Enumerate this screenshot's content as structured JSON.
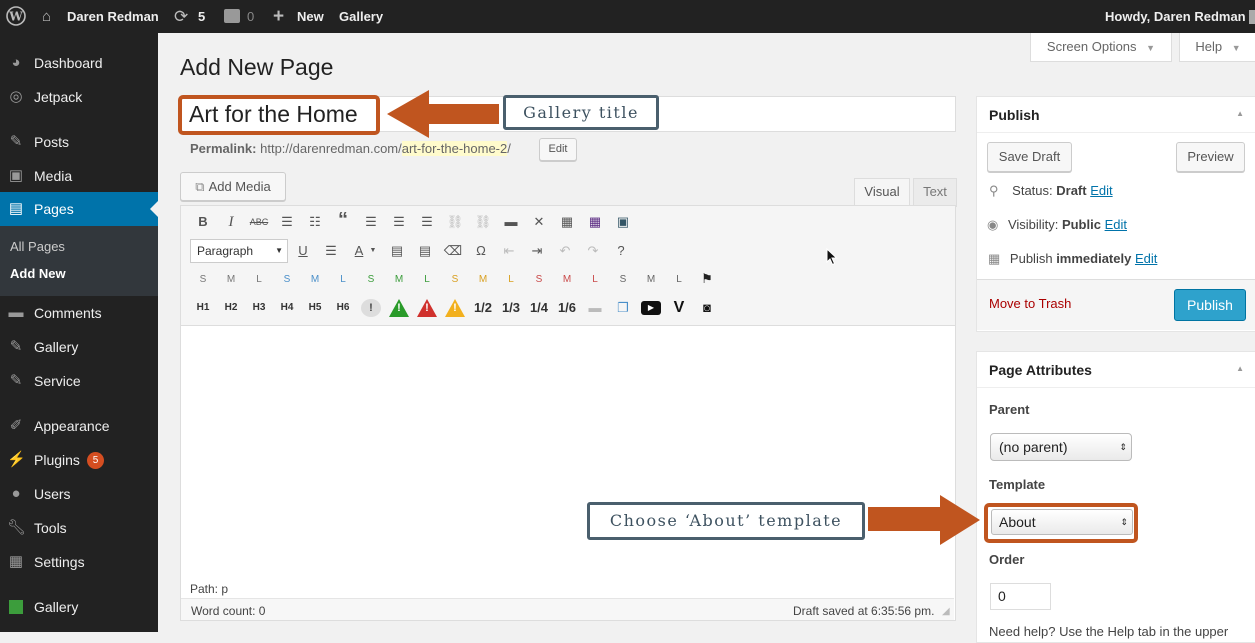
{
  "admin_bar": {
    "site_name": "Daren Redman",
    "updates_count": "5",
    "comments_count": "0",
    "new_label": "New",
    "gallery_label": "Gallery",
    "howdy": "Howdy, Daren Redman"
  },
  "sidebar": {
    "items": [
      {
        "label": "Dashboard",
        "icon": "dashboard-icon"
      },
      {
        "label": "Jetpack",
        "icon": "jetpack-icon"
      },
      {
        "label": "Posts",
        "icon": "pin-icon"
      },
      {
        "label": "Media",
        "icon": "media-icon"
      },
      {
        "label": "Pages",
        "icon": "pages-icon"
      },
      {
        "label": "Comments",
        "icon": "comment-icon"
      },
      {
        "label": "Gallery",
        "icon": "pin-icon"
      },
      {
        "label": "Service",
        "icon": "pin-icon"
      },
      {
        "label": "Appearance",
        "icon": "brush-icon"
      },
      {
        "label": "Plugins",
        "icon": "plug-icon",
        "badge": "5"
      },
      {
        "label": "Users",
        "icon": "users-icon"
      },
      {
        "label": "Tools",
        "icon": "wrench-icon"
      },
      {
        "label": "Settings",
        "icon": "settings-icon"
      },
      {
        "label": "Gallery",
        "icon": "green-square-icon"
      }
    ],
    "submenu": [
      "All Pages",
      "Add New"
    ]
  },
  "screen_options": {
    "label": "Screen Options",
    "help": "Help"
  },
  "page_title": "Add New Page",
  "title_input_value": "Art for the Home",
  "permalink": {
    "label": "Permalink:",
    "base": "http://darenredman.com/",
    "slug": "art-for-the-home-2",
    "trail": "/",
    "edit": "Edit"
  },
  "editor": {
    "add_media": "Add Media",
    "tab_visual": "Visual",
    "tab_text": "Text",
    "format_select": "Paragraph",
    "row4_labels": [
      "H1",
      "H2",
      "H3",
      "H4",
      "H5",
      "H6",
      "!",
      "!",
      "!",
      "!",
      "1/2",
      "1/3",
      "1/4",
      "1/6"
    ],
    "path": "Path: p",
    "word_count": "Word count: 0",
    "draft_saved": "Draft saved at 6:35:56 pm."
  },
  "publish_box": {
    "title": "Publish",
    "save_draft": "Save Draft",
    "preview": "Preview",
    "status_label": "Status:",
    "status_value": "Draft",
    "visibility_label": "Visibility:",
    "visibility_value": "Public",
    "publish_label": "Publish",
    "publish_value": "immediately",
    "edit": "Edit",
    "move_to_trash": "Move to Trash",
    "publish_button": "Publish"
  },
  "page_attributes": {
    "title": "Page Attributes",
    "parent_label": "Parent",
    "parent_value": "(no parent)",
    "template_label": "Template",
    "template_value": "About",
    "order_label": "Order",
    "order_value": "0",
    "help_text": "Need help? Use the Help tab in the upper"
  },
  "annotations": {
    "gallery_title": "Gallery title",
    "choose_template": "Choose ‘About’ template"
  },
  "colors": {
    "accent": "#0073aa",
    "annotation_orange": "#c0551f",
    "annotation_border": "#4a5f6d",
    "publish_blue": "#2ea2cc",
    "trash_red": "#a00"
  }
}
